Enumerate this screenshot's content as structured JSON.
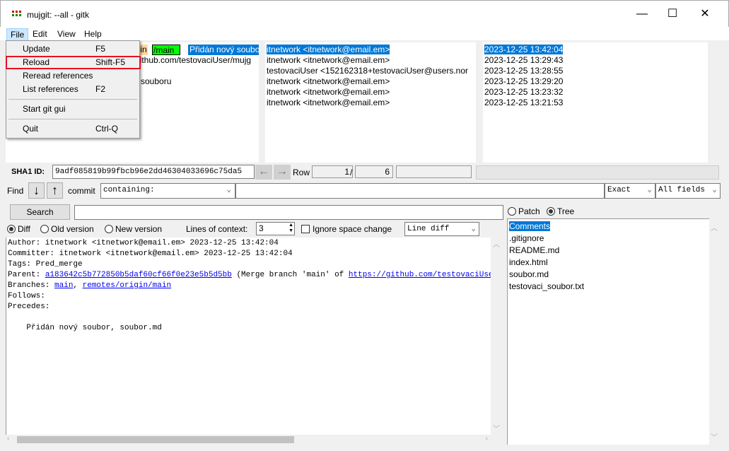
{
  "window": {
    "title": "mujgit: --all - gitk",
    "minimize": "—",
    "maximize": "☐",
    "close": "✕"
  },
  "menubar": [
    "File",
    "Edit",
    "View",
    "Help"
  ],
  "file_menu": {
    "items": [
      {
        "label": "Update",
        "shortcut": "F5"
      },
      {
        "label": "Reload",
        "shortcut": "Shift-F5"
      },
      {
        "label": "Reread references",
        "shortcut": ""
      },
      {
        "label": "List references",
        "shortcut": "F2"
      },
      {
        "label": "Start git gui",
        "shortcut": ""
      },
      {
        "label": "Quit",
        "shortcut": "Ctrl-Q"
      }
    ],
    "highlighted": "Reload",
    "highlight_color": "#e81123"
  },
  "graph": {
    "remote_tag_part": "igin",
    "branch_tag_part": "/main",
    "rows": [
      "Přidán nový soubo",
      "github.com/testovaciUser/mujg",
      "",
      "souboru"
    ]
  },
  "authors": [
    "itnetwork <itnetwork@email.em>",
    "itnetwork <itnetwork@email.em>",
    "testovaciUser <152162318+testovaciUser@users.nor",
    "itnetwork <itnetwork@email.em>",
    "itnetwork <itnetwork@email.em>",
    "itnetwork <itnetwork@email.em>"
  ],
  "dates": [
    "2023-12-25 13:42:04",
    "2023-12-25 13:29:43",
    "2023-12-25 13:28:55",
    "2023-12-25 13:29:20",
    "2023-12-25 13:23:32",
    "2023-12-25 13:21:53"
  ],
  "sha": {
    "label": "SHA1 ID:",
    "value": "9adf085819b99fbcb96e2dd46304033696c75da5",
    "row_label": "Row",
    "row": "1",
    "sep": "/",
    "total": "6"
  },
  "find": {
    "label": "Find",
    "commit_label": "commit",
    "type": "containing:",
    "match": "Exact",
    "fields": "All fields",
    "value": ""
  },
  "search": {
    "button": "Search",
    "value": ""
  },
  "diffopts": {
    "diff": "Diff",
    "old": "Old version",
    "new": "New version",
    "context_label": "Lines of context:",
    "context": "3",
    "ignore": "Ignore space change",
    "mode": "Line diff"
  },
  "details": {
    "author": "Author: itnetwork <itnetwork@email.em>  2023-12-25 13:42:04",
    "committer": "Committer: itnetwork <itnetwork@email.em>  2023-12-25 13:42:04",
    "tags": "Tags: Pred_merge",
    "parent_label": "Parent: ",
    "parent_sha": "a183642c5b772850b5daf60cf66f0e23e5b5d5bb",
    "parent_msg": " (Merge branch 'main' of ",
    "parent_url": "https://github.com/testovaciUser/mujgit",
    "branches_label": "Branches: ",
    "branch1": "main",
    "comma": ", ",
    "branch2": "remotes/origin/main",
    "follows": "Follows:",
    "precedes": "Precedes:",
    "message": "    Přidán nový soubor, soubor.md"
  },
  "tree": {
    "patch": "Patch",
    "tree": "Tree",
    "files": [
      "Comments",
      ".gitignore",
      "README.md",
      "index.html",
      "soubor.md",
      "testovaci_soubor.txt"
    ]
  }
}
